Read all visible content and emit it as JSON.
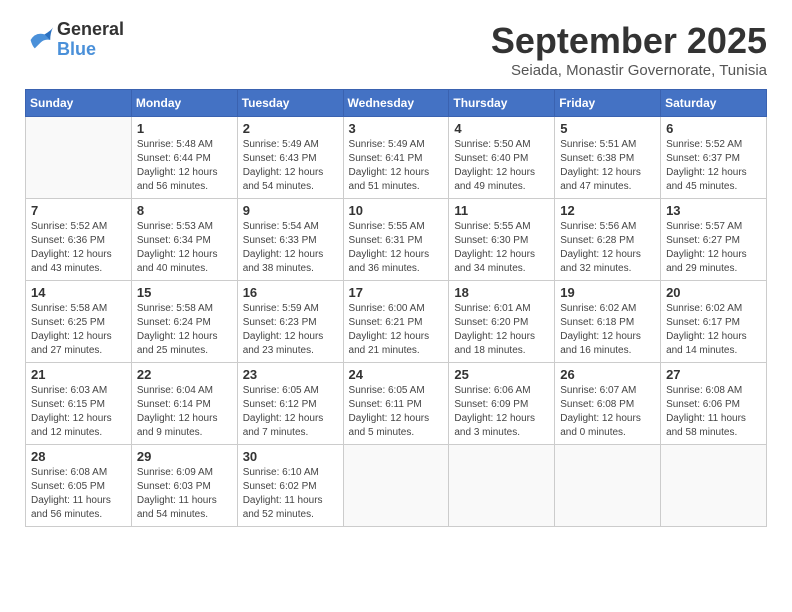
{
  "logo": {
    "line1": "General",
    "line2": "Blue"
  },
  "title": "September 2025",
  "location": "Seiada, Monastir Governorate, Tunisia",
  "weekdays": [
    "Sunday",
    "Monday",
    "Tuesday",
    "Wednesday",
    "Thursday",
    "Friday",
    "Saturday"
  ],
  "weeks": [
    [
      null,
      {
        "day": 1,
        "sunrise": "5:48 AM",
        "sunset": "6:44 PM",
        "daylight": "12 hours and 56 minutes."
      },
      {
        "day": 2,
        "sunrise": "5:49 AM",
        "sunset": "6:43 PM",
        "daylight": "12 hours and 54 minutes."
      },
      {
        "day": 3,
        "sunrise": "5:49 AM",
        "sunset": "6:41 PM",
        "daylight": "12 hours and 51 minutes."
      },
      {
        "day": 4,
        "sunrise": "5:50 AM",
        "sunset": "6:40 PM",
        "daylight": "12 hours and 49 minutes."
      },
      {
        "day": 5,
        "sunrise": "5:51 AM",
        "sunset": "6:38 PM",
        "daylight": "12 hours and 47 minutes."
      },
      {
        "day": 6,
        "sunrise": "5:52 AM",
        "sunset": "6:37 PM",
        "daylight": "12 hours and 45 minutes."
      }
    ],
    [
      {
        "day": 7,
        "sunrise": "5:52 AM",
        "sunset": "6:36 PM",
        "daylight": "12 hours and 43 minutes."
      },
      {
        "day": 8,
        "sunrise": "5:53 AM",
        "sunset": "6:34 PM",
        "daylight": "12 hours and 40 minutes."
      },
      {
        "day": 9,
        "sunrise": "5:54 AM",
        "sunset": "6:33 PM",
        "daylight": "12 hours and 38 minutes."
      },
      {
        "day": 10,
        "sunrise": "5:55 AM",
        "sunset": "6:31 PM",
        "daylight": "12 hours and 36 minutes."
      },
      {
        "day": 11,
        "sunrise": "5:55 AM",
        "sunset": "6:30 PM",
        "daylight": "12 hours and 34 minutes."
      },
      {
        "day": 12,
        "sunrise": "5:56 AM",
        "sunset": "6:28 PM",
        "daylight": "12 hours and 32 minutes."
      },
      {
        "day": 13,
        "sunrise": "5:57 AM",
        "sunset": "6:27 PM",
        "daylight": "12 hours and 29 minutes."
      }
    ],
    [
      {
        "day": 14,
        "sunrise": "5:58 AM",
        "sunset": "6:25 PM",
        "daylight": "12 hours and 27 minutes."
      },
      {
        "day": 15,
        "sunrise": "5:58 AM",
        "sunset": "6:24 PM",
        "daylight": "12 hours and 25 minutes."
      },
      {
        "day": 16,
        "sunrise": "5:59 AM",
        "sunset": "6:23 PM",
        "daylight": "12 hours and 23 minutes."
      },
      {
        "day": 17,
        "sunrise": "6:00 AM",
        "sunset": "6:21 PM",
        "daylight": "12 hours and 21 minutes."
      },
      {
        "day": 18,
        "sunrise": "6:01 AM",
        "sunset": "6:20 PM",
        "daylight": "12 hours and 18 minutes."
      },
      {
        "day": 19,
        "sunrise": "6:02 AM",
        "sunset": "6:18 PM",
        "daylight": "12 hours and 16 minutes."
      },
      {
        "day": 20,
        "sunrise": "6:02 AM",
        "sunset": "6:17 PM",
        "daylight": "12 hours and 14 minutes."
      }
    ],
    [
      {
        "day": 21,
        "sunrise": "6:03 AM",
        "sunset": "6:15 PM",
        "daylight": "12 hours and 12 minutes."
      },
      {
        "day": 22,
        "sunrise": "6:04 AM",
        "sunset": "6:14 PM",
        "daylight": "12 hours and 9 minutes."
      },
      {
        "day": 23,
        "sunrise": "6:05 AM",
        "sunset": "6:12 PM",
        "daylight": "12 hours and 7 minutes."
      },
      {
        "day": 24,
        "sunrise": "6:05 AM",
        "sunset": "6:11 PM",
        "daylight": "12 hours and 5 minutes."
      },
      {
        "day": 25,
        "sunrise": "6:06 AM",
        "sunset": "6:09 PM",
        "daylight": "12 hours and 3 minutes."
      },
      {
        "day": 26,
        "sunrise": "6:07 AM",
        "sunset": "6:08 PM",
        "daylight": "12 hours and 0 minutes."
      },
      {
        "day": 27,
        "sunrise": "6:08 AM",
        "sunset": "6:06 PM",
        "daylight": "11 hours and 58 minutes."
      }
    ],
    [
      {
        "day": 28,
        "sunrise": "6:08 AM",
        "sunset": "6:05 PM",
        "daylight": "11 hours and 56 minutes."
      },
      {
        "day": 29,
        "sunrise": "6:09 AM",
        "sunset": "6:03 PM",
        "daylight": "11 hours and 54 minutes."
      },
      {
        "day": 30,
        "sunrise": "6:10 AM",
        "sunset": "6:02 PM",
        "daylight": "11 hours and 52 minutes."
      },
      null,
      null,
      null,
      null
    ]
  ]
}
